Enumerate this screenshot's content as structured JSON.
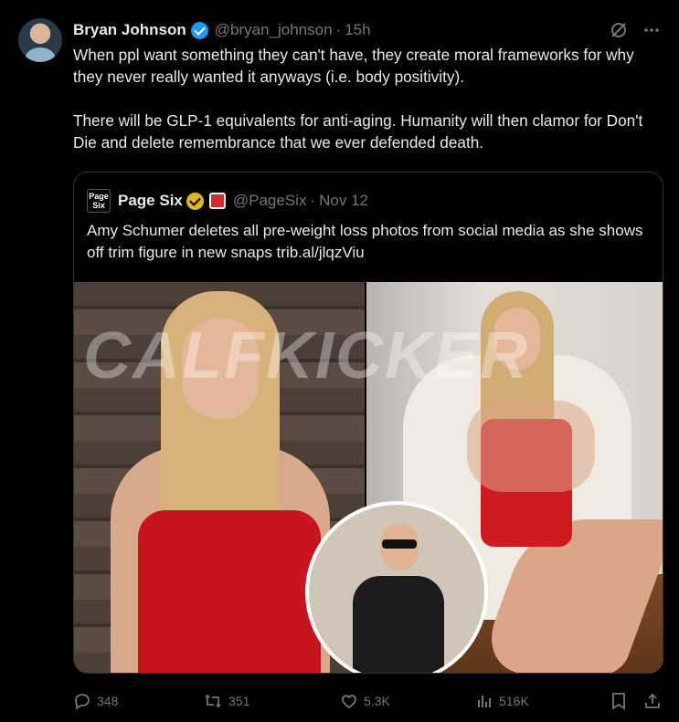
{
  "author": {
    "name": "Bryan Johnson",
    "handle": "@bryan_johnson",
    "separator": "·",
    "time": "15h"
  },
  "tweet": {
    "paragraph1": "When ppl want something they can't have, they create moral frameworks for why they never really wanted it anyways (i.e. body positivity).",
    "paragraph2": "There will be GLP-1 equivalents for anti-aging. Humanity will then clamor for Don't Die and delete remembrance that we ever defended death."
  },
  "quote": {
    "avatar_text_line1": "Page",
    "avatar_text_line2": "Six",
    "name": "Page Six",
    "handle": "@PageSix",
    "separator": "·",
    "time": "Nov 12",
    "text": "Amy Schumer deletes all pre-weight loss photos from social media as she shows off trim figure in new snaps trib.al/jlqzViu",
    "watermark": "CALFKICKER"
  },
  "actions": {
    "replies": "348",
    "reposts": "351",
    "likes": "5.3K",
    "views": "516K"
  },
  "colors": {
    "background": "#000000",
    "text": "#e7e9ea",
    "muted": "#71767b",
    "verified_blue": "#1d9bf0",
    "verified_gold": "#e2b719",
    "border": "#2f3336"
  }
}
